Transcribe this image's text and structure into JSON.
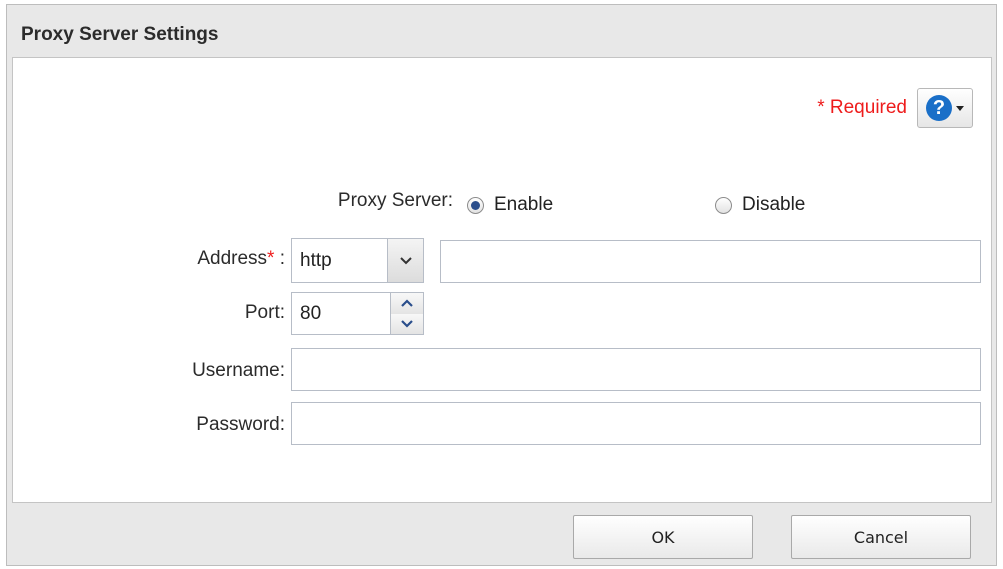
{
  "dialog": {
    "title": "Proxy Server Settings",
    "required_star": "*",
    "required_label": "Required",
    "help_glyph": "?",
    "help_icon": "question-circle-icon"
  },
  "form": {
    "proxy_server": {
      "label": "Proxy Server:",
      "options": [
        "Enable",
        "Disable"
      ],
      "selected": "Enable"
    },
    "address": {
      "label": "Address",
      "required_star": "*",
      "colon": ":",
      "protocol_value": "http",
      "host_value": ""
    },
    "port": {
      "label": "Port:",
      "value": "80"
    },
    "username": {
      "label": "Username:",
      "value": ""
    },
    "password": {
      "label": "Password:",
      "value": ""
    }
  },
  "footer": {
    "ok_label": "OK",
    "cancel_label": "Cancel"
  },
  "colors": {
    "required": "#ee1c1c",
    "help_icon": "#1a6fc8",
    "radio_dot": "#2a4e8c"
  }
}
